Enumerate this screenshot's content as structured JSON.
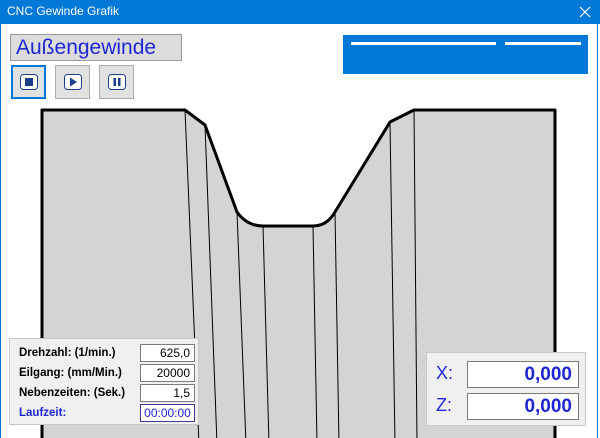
{
  "window": {
    "title": "CNC Gewinde Grafik"
  },
  "thread_type": "Außengewinde",
  "controls": [
    {
      "name": "stop",
      "icon": "stop-icon"
    },
    {
      "name": "play",
      "icon": "play-icon"
    },
    {
      "name": "pause",
      "icon": "pause-icon"
    }
  ],
  "params": {
    "drehzahl_label": "Drehzahl: (1/min.)",
    "drehzahl_value": "625,0",
    "eilgang_label": "Eilgang: (mm/Min.)",
    "eilgang_value": "20000",
    "nebenzeiten_label": "Nebenzeiten: (Sek.)",
    "nebenzeiten_value": "1,5",
    "laufzeit_label": "Laufzeit:",
    "laufzeit_value": "00:00:00"
  },
  "coords": {
    "x_label": "X:",
    "x_value": "0,000",
    "z_label": "Z:",
    "z_value": "0,000"
  },
  "colors": {
    "accent": "#0078d7",
    "text_blue": "#1e26d6",
    "part_fill": "#d4d4d4"
  }
}
